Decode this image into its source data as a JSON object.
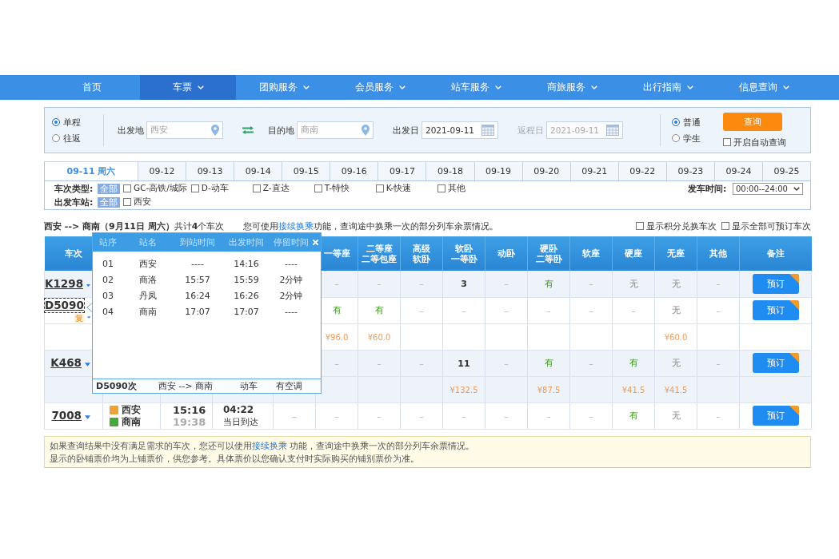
{
  "nav": {
    "items": [
      {
        "label": "首页",
        "dropdown": false,
        "selected": false
      },
      {
        "label": "车票",
        "dropdown": true,
        "selected": true
      },
      {
        "label": "团购服务",
        "dropdown": true,
        "selected": false
      },
      {
        "label": "会员服务",
        "dropdown": true,
        "selected": false
      },
      {
        "label": "站车服务",
        "dropdown": true,
        "selected": false
      },
      {
        "label": "商旅服务",
        "dropdown": true,
        "selected": false
      },
      {
        "label": "出行指南",
        "dropdown": true,
        "selected": false
      },
      {
        "label": "信息查询",
        "dropdown": true,
        "selected": false
      }
    ]
  },
  "search": {
    "trip_types": [
      {
        "label": "单程",
        "selected": true
      },
      {
        "label": "往返",
        "selected": false
      }
    ],
    "from": {
      "label": "出发地",
      "value": "西安"
    },
    "to": {
      "label": "目的地",
      "value": "商南"
    },
    "depart_date": {
      "label": "出发日",
      "value": "2021-09-11",
      "disabled": false
    },
    "return_date": {
      "label": "返程日",
      "value": "2021-09-11",
      "disabled": true
    },
    "passenger_types": [
      {
        "label": "普通",
        "selected": true
      },
      {
        "label": "学生",
        "selected": false
      }
    ],
    "query_button": "查询",
    "auto_query": {
      "label": "开启自动查询",
      "checked": false
    }
  },
  "date_tabs": [
    {
      "label": "09-11 周六",
      "selected": true
    },
    {
      "label": "09-12",
      "selected": false
    },
    {
      "label": "09-13",
      "selected": false
    },
    {
      "label": "09-14",
      "selected": false
    },
    {
      "label": "09-15",
      "selected": false
    },
    {
      "label": "09-16",
      "selected": false
    },
    {
      "label": "09-17",
      "selected": false
    },
    {
      "label": "09-18",
      "selected": false
    },
    {
      "label": "09-19",
      "selected": false
    },
    {
      "label": "09-20",
      "selected": false
    },
    {
      "label": "09-21",
      "selected": false
    },
    {
      "label": "09-22",
      "selected": false
    },
    {
      "label": "09-23",
      "selected": false
    },
    {
      "label": "09-24",
      "selected": false
    },
    {
      "label": "09-25",
      "selected": false
    }
  ],
  "filters": {
    "train_types": {
      "label": "车次类型:",
      "all": {
        "label": "全部",
        "selected": true
      },
      "options": [
        {
          "label": "GC-高铁/城际",
          "checked": false
        },
        {
          "label": "D-动车",
          "checked": false
        },
        {
          "label": "Z-直达",
          "checked": false
        },
        {
          "label": "T-特快",
          "checked": false
        },
        {
          "label": "K-快速",
          "checked": false
        },
        {
          "label": "其他",
          "checked": false
        }
      ]
    },
    "stations": {
      "label": "出发车站:",
      "all": {
        "label": "全部",
        "selected": true
      },
      "options": [
        {
          "label": "西安",
          "checked": false
        }
      ]
    },
    "depart_time": {
      "label": "发车时间:",
      "value": "00:00--24:00"
    }
  },
  "summary": {
    "route": "**西安 --> 商南（9月11日 周六）**共计**4**个车次",
    "hint": {
      "before": "您可使用",
      "link": "接续换乘",
      "after": "功能，查询途中换乘一次的部分列车余票情况。"
    },
    "options": [
      {
        "label": "显示积分兑换车次",
        "checked": false
      },
      {
        "label": "显示全部可预订车次",
        "checked": false
      }
    ]
  },
  "table": {
    "columns": [
      {
        "lines": [
          "车次"
        ]
      },
      {
        "lines": [
          "一等座"
        ]
      },
      {
        "lines": [
          "二等座",
          "二等包座"
        ]
      },
      {
        "lines": [
          "高级",
          "软卧"
        ]
      },
      {
        "lines": [
          "软卧",
          "一等卧"
        ]
      },
      {
        "lines": [
          "动卧"
        ]
      },
      {
        "lines": [
          "硬卧",
          "二等卧"
        ]
      },
      {
        "lines": [
          "软座"
        ]
      },
      {
        "lines": [
          "硬座"
        ]
      },
      {
        "lines": [
          "无座"
        ]
      },
      {
        "lines": [
          "其他"
        ]
      },
      {
        "lines": [
          "备注"
        ]
      }
    ],
    "trains": [
      {
        "number": "K1298",
        "selected": false,
        "expanded": false,
        "seats": [
          {
            "value": "–",
            "kind": "na"
          },
          {
            "value": "–",
            "kind": "na"
          },
          {
            "value": "–",
            "kind": "na"
          },
          {
            "value": "3",
            "kind": "count"
          },
          {
            "value": "–",
            "kind": "na"
          },
          {
            "value": "有",
            "kind": "available"
          },
          {
            "value": "–",
            "kind": "na"
          },
          {
            "value": "无",
            "kind": "none"
          },
          {
            "value": "无",
            "kind": "none"
          },
          {
            "value": "–",
            "kind": "na"
          }
        ],
        "book_button": "预订"
      },
      {
        "number": "D5090",
        "badge": "复",
        "selected": true,
        "expanded": true,
        "seats": [
          {
            "value": "有",
            "kind": "available",
            "price": "¥96.0"
          },
          {
            "value": "有",
            "kind": "available",
            "price": "¥60.0"
          },
          {
            "value": "–",
            "kind": "na"
          },
          {
            "value": "–",
            "kind": "na"
          },
          {
            "value": "–",
            "kind": "na"
          },
          {
            "value": "–",
            "kind": "na"
          },
          {
            "value": "–",
            "kind": "na"
          },
          {
            "value": "–",
            "kind": "na"
          },
          {
            "value": "无",
            "kind": "none",
            "price": "¥60.0"
          },
          {
            "value": "–",
            "kind": "na"
          }
        ],
        "book_button": "预订"
      },
      {
        "number": "K468",
        "selected": false,
        "expanded": true,
        "seats": [
          {
            "value": "–",
            "kind": "na"
          },
          {
            "value": "–",
            "kind": "na"
          },
          {
            "value": "–",
            "kind": "na"
          },
          {
            "value": "11",
            "kind": "count",
            "price": "¥132.5"
          },
          {
            "value": "–",
            "kind": "na"
          },
          {
            "value": "有",
            "kind": "available",
            "price": "¥87.5"
          },
          {
            "value": "–",
            "kind": "na"
          },
          {
            "value": "有",
            "kind": "available",
            "price": "¥41.5"
          },
          {
            "value": "无",
            "kind": "none",
            "price": "¥41.5"
          },
          {
            "value": "–",
            "kind": "na"
          }
        ],
        "book_button": "预订"
      },
      {
        "number": "7008",
        "selected": false,
        "expanded": false,
        "depart_station": {
          "name": "西安",
          "color": "#e8a33c"
        },
        "arrive_station": {
          "name": "商南",
          "color": "#45a83a"
        },
        "depart_time": "15:16",
        "arrive_time": "19:38",
        "duration": "04:22",
        "arrival_day": "当日到达",
        "business_seat": {
          "value": "–",
          "kind": "na"
        },
        "seats": [
          {
            "value": "–",
            "kind": "na"
          },
          {
            "value": "–",
            "kind": "na"
          },
          {
            "value": "–",
            "kind": "na"
          },
          {
            "value": "–",
            "kind": "na"
          },
          {
            "value": "–",
            "kind": "na"
          },
          {
            "value": "–",
            "kind": "na"
          },
          {
            "value": "–",
            "kind": "na"
          },
          {
            "value": "有",
            "kind": "available"
          },
          {
            "value": "无",
            "kind": "none"
          },
          {
            "value": "–",
            "kind": "na"
          }
        ],
        "book_button": "预订"
      }
    ]
  },
  "popup": {
    "columns": [
      "站序",
      "站名",
      "到站时间",
      "出发时间",
      "停留时间"
    ],
    "stops": [
      {
        "order": "01",
        "station": "西安",
        "arrive": "----",
        "depart": "14:16",
        "stay": "----"
      },
      {
        "order": "02",
        "station": "商洛",
        "arrive": "15:57",
        "depart": "15:59",
        "stay": "2分钟"
      },
      {
        "order": "03",
        "station": "丹凤",
        "arrive": "16:24",
        "depart": "16:26",
        "stay": "2分钟"
      },
      {
        "order": "04",
        "station": "商南",
        "arrive": "17:07",
        "depart": "17:07",
        "stay": "----"
      }
    ],
    "footer": {
      "train": "D5090次",
      "route": "西安 --> 商南",
      "type": "动车",
      "amenity": "有空调"
    }
  },
  "notice": {
    "first": {
      "before": "如果查询结果中没有满足需求的车次，您还可以使用",
      "link": "接续换乘",
      "after": " 功能，查询途中换乘一次的部分列车余票情况。"
    },
    "second": "显示的卧铺票价均为上铺票价，供您参考。具体票价以您确认支付时实际购买的铺别票价为准。"
  }
}
